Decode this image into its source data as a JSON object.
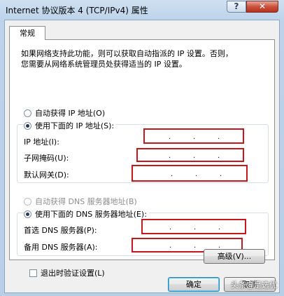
{
  "window": {
    "title": "Internet 协议版本 4 (TCP/IPv4) 属性",
    "help_label": "?",
    "close_label": "✕"
  },
  "tab": {
    "label": "常规"
  },
  "intro": {
    "line1": "如果网络支持此功能，则可以获取自动指派的 IP 设置。否则，",
    "line2": "您需要从网络系统管理员处获得适当的 IP 设置。"
  },
  "ip_section": {
    "auto_label": "自动获得 IP 地址(O)",
    "manual_label": "使用下面的 IP 地址(S):",
    "selected": "manual",
    "fields": [
      {
        "label": "IP 地址(I):",
        "value": ""
      },
      {
        "label": "子网掩码(U):",
        "value": ""
      },
      {
        "label": "默认网关(D):",
        "value": ""
      }
    ]
  },
  "dns_section": {
    "auto_label": "自动获得 DNS 服务器地址(B)",
    "manual_label": "使用下面的 DNS 服务器地址(E):",
    "selected": "manual",
    "auto_disabled": true,
    "fields": [
      {
        "label": "首选 DNS 服务器(P):",
        "value": ""
      },
      {
        "label": "备用 DNS 服务器(A):",
        "value": ""
      }
    ]
  },
  "validate": {
    "label": "退出时验证设置(L)",
    "checked": false
  },
  "buttons": {
    "advanced": "高级(V)...",
    "ok": "确定",
    "cancel": "取消"
  },
  "watermark": "头条@是选优",
  "colors": {
    "highlight_border": "#c8161d",
    "titlebar": "#bcd3ea"
  }
}
